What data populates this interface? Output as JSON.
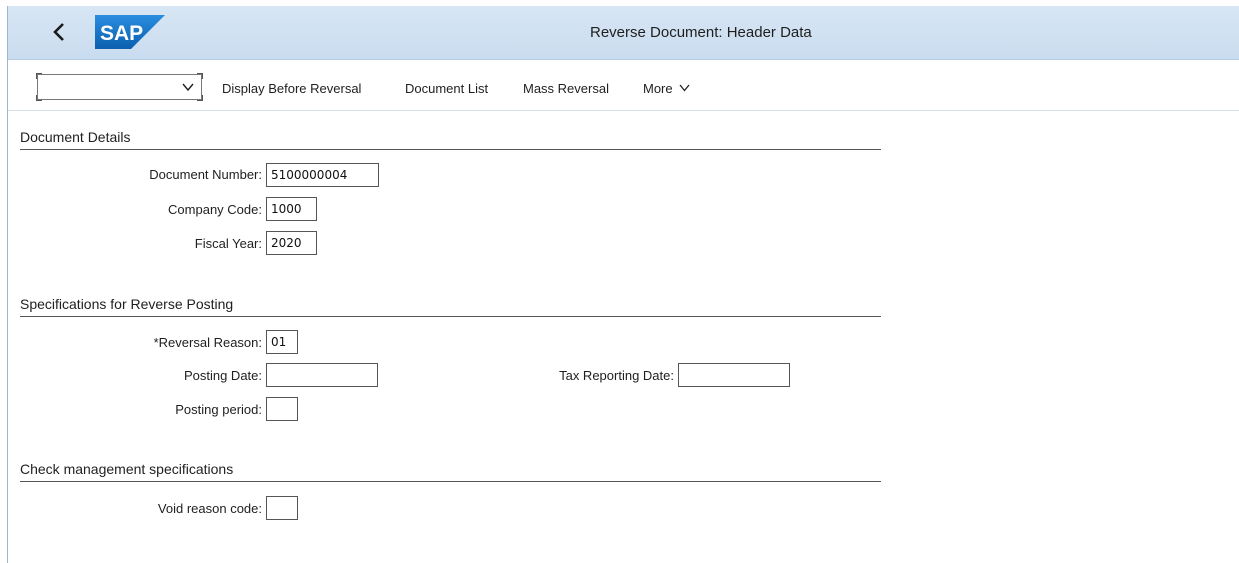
{
  "shell": {
    "logo_text": "SAP",
    "title": "Reverse Document: Header Data",
    "accent": "#1670c4"
  },
  "toolbar": {
    "select_value": "",
    "display_before_reversal": "Display Before Reversal",
    "document_list": "Document List",
    "mass_reversal": "Mass Reversal",
    "more": "More"
  },
  "document_details": {
    "title": "Document Details",
    "document_number_label": "Document Number:",
    "document_number": "5100000004",
    "company_code_label": "Company Code:",
    "company_code": "1000",
    "fiscal_year_label": "Fiscal Year:",
    "fiscal_year": "2020"
  },
  "reverse_posting": {
    "title": "Specifications for Reverse Posting",
    "required_marker": "*",
    "reversal_reason_label": "Reversal Reason:",
    "reversal_reason": "01",
    "posting_date_label": "Posting Date:",
    "posting_date": "",
    "tax_reporting_date_label": "Tax Reporting Date:",
    "tax_reporting_date": "",
    "posting_period_label": "Posting period:",
    "posting_period": ""
  },
  "check_management": {
    "title": "Check management specifications",
    "void_reason_code_label": "Void reason code:",
    "void_reason_code": ""
  }
}
